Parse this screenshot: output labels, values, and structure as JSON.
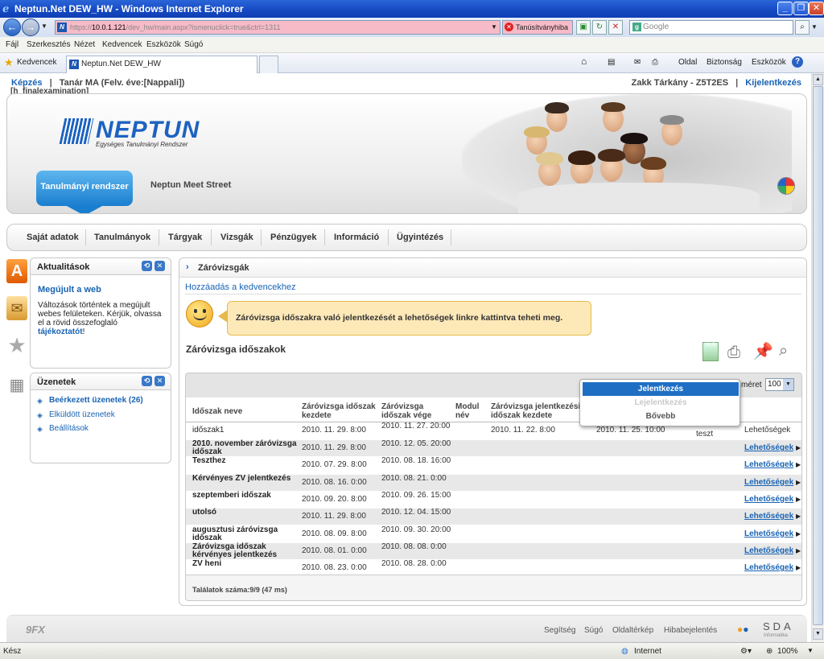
{
  "window": {
    "title": "Neptun.Net DEW_HW - Windows Internet Explorer"
  },
  "address": {
    "url_prefix": "https://",
    "host": "10.0.1.121",
    "url_rest": "/dev_hw/main.aspx?ismenuclick=true&ctrl=1311",
    "cert_error": "Tanúsítványhiba",
    "search_placeholder": "Google"
  },
  "menu": [
    "Fájl",
    "Szerkesztés",
    "Nézet",
    "Kedvencek",
    "Eszközök",
    "Súgó"
  ],
  "favbar": {
    "favorites": "Kedvencek",
    "tab": "Neptun.Net DEW_HW",
    "cmd_page": "Oldal",
    "cmd_security": "Biztonság",
    "cmd_tools": "Eszközök"
  },
  "top": {
    "kepzes": "Képzés",
    "role": "Tanár MA (Felv. éve:[Nappali])",
    "page_id": "[h_finalexamination]",
    "user": "Zakk Tárkány - Z5T2ES",
    "logout": "Kijelentkezés",
    "sep": "|"
  },
  "header": {
    "logo": "NEPTUN",
    "logo_sub": "Egységes Tanulmányi Rendszer",
    "tab_active": "Tanulmányi rendszer",
    "tab_other": "Neptun Meet Street"
  },
  "nav": [
    "Saját adatok",
    "Tanulmányok",
    "Tárgyak",
    "Vizsgák",
    "Pénzügyek",
    "Információ",
    "Ügyintézés"
  ],
  "news": {
    "title": "Aktualitások",
    "headline": "Megújult a web",
    "text": "Változások történtek a megújult webes felületeken. Kérjük, olvassa el a rövid összefoglaló",
    "link": "tájékoztatót",
    "tail": "!"
  },
  "messages": {
    "title": "Üzenetek",
    "inbox": "Beérkezett üzenetek (26)",
    "sent": "Elküldött üzenetek",
    "settings": "Beállítások"
  },
  "main": {
    "title": "Záróvizsgák",
    "add_fav": "Hozzáadás a kedvencekhez",
    "info": "Záróvizsga időszakra való jelentkezését a lehetőségek linkre kattintva teheti meg.",
    "section": "Záróvizsga időszakok",
    "page_size_label": "méret",
    "page_size": "100",
    "headers": [
      "Időszak neve",
      "Záróvizsga időszak kezdete",
      "Záróvizsga időszak vége",
      "Modul név",
      "Záróvizsga jelentkezési időszak kezdete"
    ],
    "first_row": {
      "name": "időszak1",
      "start": "2010. 11. 29. 8:00",
      "end": "2010. 11. 27. 20:00",
      "reg_start": "2010. 11. 22. 8:00",
      "reg_end": "2010. 11. 25. 10:00",
      "extra": "teszt",
      "action": "Lehetőségek"
    },
    "rows": [
      {
        "name": "2010. november záróvizsga időszak",
        "start": "2010. 11. 29. 8:00",
        "end": "2010. 12. 05. 20:00",
        "action": "Lehetőségek"
      },
      {
        "name": "Teszthez",
        "start": "2010. 07. 29. 8:00",
        "end": "2010. 08. 18. 16:00",
        "action": "Lehetőségek"
      },
      {
        "name": "Kérvényes ZV jelentkezés",
        "start": "2010. 08. 16. 0:00",
        "end": "2010. 08. 21. 0:00",
        "action": "Lehetőségek"
      },
      {
        "name": "szeptemberi időszak",
        "start": "2010. 09. 20. 8:00",
        "end": "2010. 09. 26. 15:00",
        "action": "Lehetőségek"
      },
      {
        "name": "utolsó",
        "start": "2010. 11. 29. 8:00",
        "end": "2010. 12. 04. 15:00",
        "action": "Lehetőségek"
      },
      {
        "name": "augusztusi záróvizsga időszak",
        "start": "2010. 08. 09. 8:00",
        "end": "2010. 09. 30. 20:00",
        "action": "Lehetőségek"
      },
      {
        "name": "Záróvizsga időszak kérvényes jelentkezés",
        "start": "2010. 08. 01. 0:00",
        "end": "2010. 08. 08. 0:00",
        "action": "Lehetőségek"
      },
      {
        "name": "ZV heni",
        "start": "2010. 08. 23. 0:00",
        "end": "2010. 08. 28. 0:00",
        "action": "Lehetőségek"
      }
    ],
    "result_count": "Találatok száma:9/9 (47 ms)"
  },
  "popup": {
    "item1": "Jelentkezés",
    "item2": "Lejelentkezés",
    "item3": "Bővebb"
  },
  "footer": {
    "logo": "9FX",
    "links": [
      "Segítség",
      "Súgó",
      "Oldaltérkép",
      "Hibabejelentés"
    ],
    "brand": "SDA",
    "brand_sub": "Informatika"
  },
  "status": {
    "left": "Kész",
    "zone": "Internet",
    "zoom": "100%"
  },
  "colors": {
    "link": "#1863b4",
    "titlebar": "#1548c2",
    "bubble": "#fde9b8",
    "popup_active": "#1e6fc4"
  }
}
